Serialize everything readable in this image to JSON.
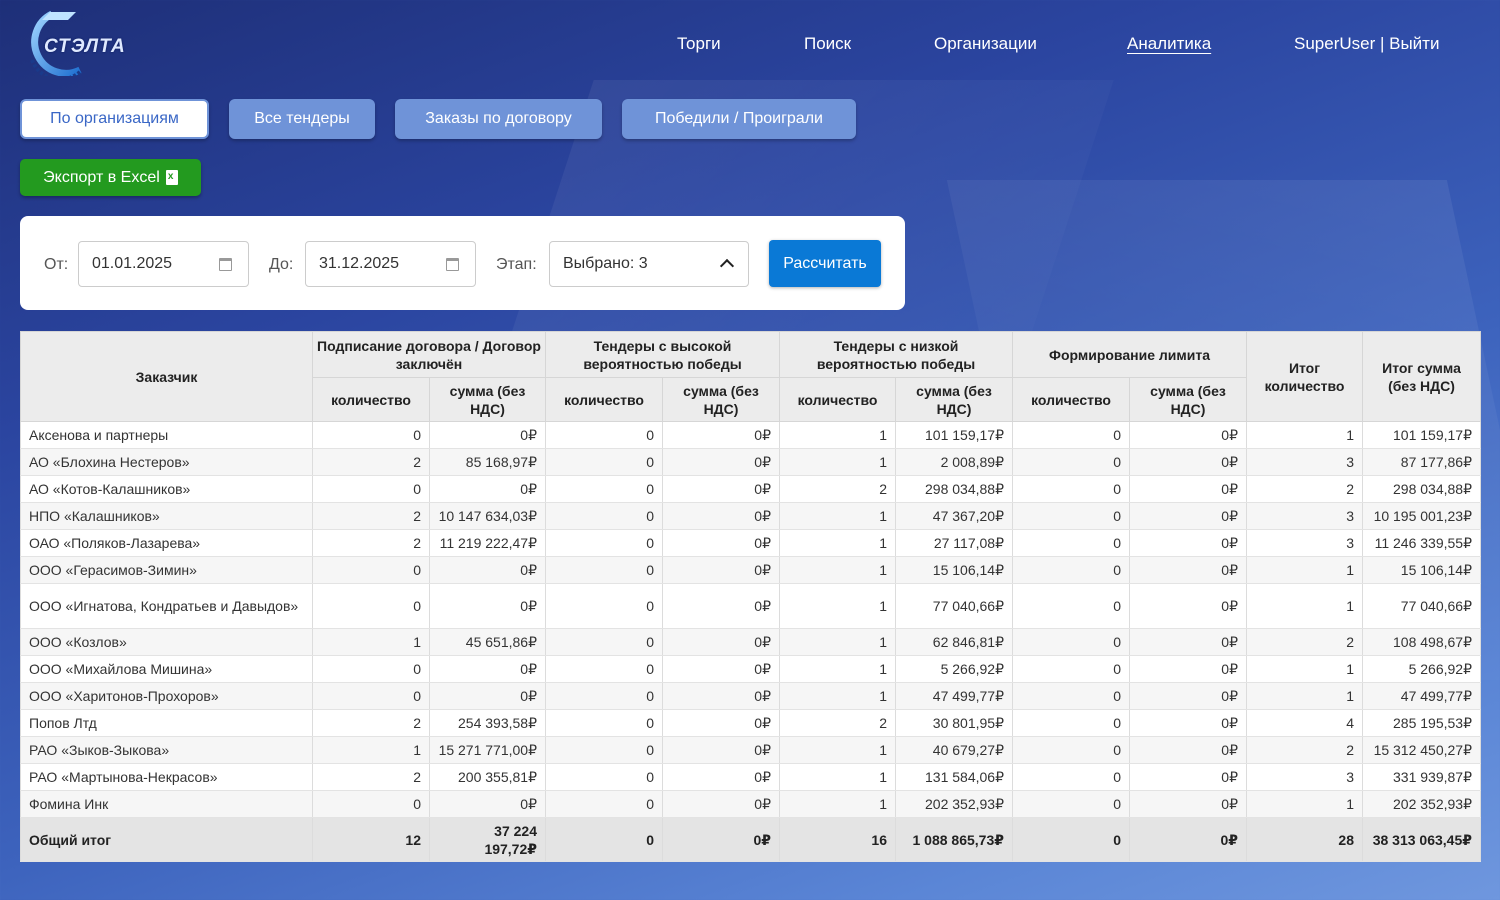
{
  "header": {
    "logo_text": "СТЭЛТА",
    "nav": [
      "Торги",
      "Поиск",
      "Организации",
      "Аналитика",
      "SuperUser | Выйти"
    ],
    "active_nav": "Аналитика"
  },
  "tabs": [
    "По организациям",
    "Все тендеры",
    "Заказы по договору",
    "Победили / Проиграли"
  ],
  "active_tab": "По организациям",
  "export_label": "Экспорт в Excel",
  "filter": {
    "from_label": "От:",
    "from_value": "01.01.2025",
    "to_label": "До:",
    "to_value": "31.12.2025",
    "stage_label": "Этап:",
    "stage_value": "Выбрано: 3",
    "calc_label": "Рассчитать"
  },
  "table": {
    "col_customer": "Заказчик",
    "groups": [
      "Подписание договора / Договор заключён",
      "Тендеры с высокой вероятностью победы",
      "Тендеры с низкой вероятностью победы",
      "Формирование лимита"
    ],
    "sub_count": "количество",
    "sub_sum": "сумма (без НДС)",
    "col_total_count": "Итог количество",
    "col_total_sum": "Итог сумма (без НДС)",
    "rows": [
      [
        "Аксенова и партнеры",
        "0",
        "0₽",
        "0",
        "0₽",
        "1",
        "101 159,17₽",
        "0",
        "0₽",
        "1",
        "101 159,17₽"
      ],
      [
        "АО «Блохина Нестеров»",
        "2",
        "85 168,97₽",
        "0",
        "0₽",
        "1",
        "2 008,89₽",
        "0",
        "0₽",
        "3",
        "87 177,86₽"
      ],
      [
        "АО «Котов-Калашников»",
        "0",
        "0₽",
        "0",
        "0₽",
        "2",
        "298 034,88₽",
        "0",
        "0₽",
        "2",
        "298 034,88₽"
      ],
      [
        "НПО «Калашников»",
        "2",
        "10 147 634,03₽",
        "0",
        "0₽",
        "1",
        "47 367,20₽",
        "0",
        "0₽",
        "3",
        "10 195 001,23₽"
      ],
      [
        "ОАО «Поляков-Лазарева»",
        "2",
        "11 219 222,47₽",
        "0",
        "0₽",
        "1",
        "27 117,08₽",
        "0",
        "0₽",
        "3",
        "11 246 339,55₽"
      ],
      [
        "ООО «Герасимов-Зимин»",
        "0",
        "0₽",
        "0",
        "0₽",
        "1",
        "15 106,14₽",
        "0",
        "0₽",
        "1",
        "15 106,14₽"
      ],
      [
        "ООО «Игнатова, Кондратьев и Давыдов»",
        "0",
        "0₽",
        "0",
        "0₽",
        "1",
        "77 040,66₽",
        "0",
        "0₽",
        "1",
        "77 040,66₽"
      ],
      [
        "ООО «Козлов»",
        "1",
        "45 651,86₽",
        "0",
        "0₽",
        "1",
        "62 846,81₽",
        "0",
        "0₽",
        "2",
        "108 498,67₽"
      ],
      [
        "ООО «Михайлова Мишина»",
        "0",
        "0₽",
        "0",
        "0₽",
        "1",
        "5 266,92₽",
        "0",
        "0₽",
        "1",
        "5 266,92₽"
      ],
      [
        "ООО «Харитонов-Прохоров»",
        "0",
        "0₽",
        "0",
        "0₽",
        "1",
        "47 499,77₽",
        "0",
        "0₽",
        "1",
        "47 499,77₽"
      ],
      [
        "Попов Лтд",
        "2",
        "254 393,58₽",
        "0",
        "0₽",
        "2",
        "30 801,95₽",
        "0",
        "0₽",
        "4",
        "285 195,53₽"
      ],
      [
        "РАО «Зыков-Зыкова»",
        "1",
        "15 271 771,00₽",
        "0",
        "0₽",
        "1",
        "40 679,27₽",
        "0",
        "0₽",
        "2",
        "15 312 450,27₽"
      ],
      [
        "РАО «Мартынова-Некрасов»",
        "2",
        "200 355,81₽",
        "0",
        "0₽",
        "1",
        "131 584,06₽",
        "0",
        "0₽",
        "3",
        "331 939,87₽"
      ],
      [
        "Фомина Инк",
        "0",
        "0₽",
        "0",
        "0₽",
        "1",
        "202 352,93₽",
        "0",
        "0₽",
        "1",
        "202 352,93₽"
      ]
    ],
    "total": [
      "Общий итог",
      "12",
      "37 224 197,72₽",
      "0",
      "0₽",
      "16",
      "1 088 865,73₽",
      "0",
      "0₽",
      "28",
      "38 313 063,45₽"
    ]
  }
}
